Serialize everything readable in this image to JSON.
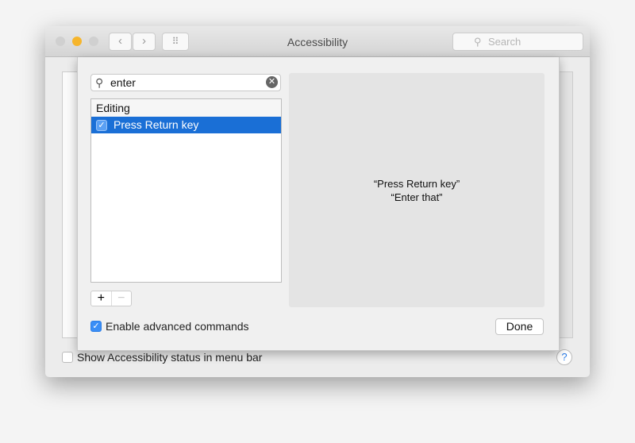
{
  "window": {
    "title": "Accessibility",
    "search_placeholder": "Search",
    "back": "‹",
    "forward": "›",
    "grid": "⠿"
  },
  "main": {
    "show_status_label": "Show Accessibility status in menu bar",
    "show_status_checked": false,
    "help": "?"
  },
  "sheet": {
    "search_value": "enter",
    "list": {
      "group": "Editing",
      "items": [
        {
          "label": "Press Return key",
          "checked": true,
          "selected": true
        }
      ]
    },
    "add": "+",
    "remove": "−",
    "detail": {
      "line1": "“Press Return key”",
      "line2": "“Enter that”"
    },
    "advanced_label": "Enable advanced commands",
    "advanced_checked": true,
    "done": "Done"
  },
  "colors": {
    "selection": "#1a6fd6",
    "checkbox": "#3a8ef6",
    "minimize": "#f6b52c"
  }
}
